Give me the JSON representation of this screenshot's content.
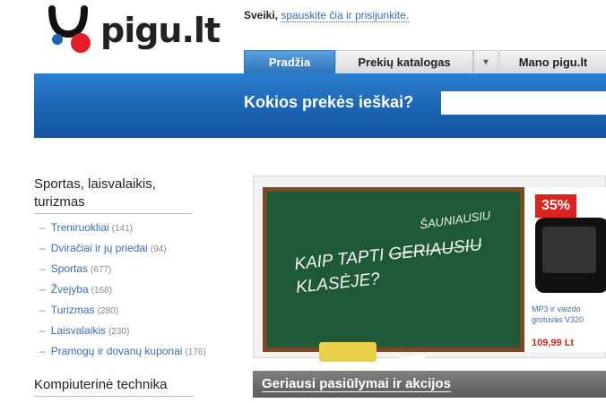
{
  "logo": {
    "text": "pigu.lt"
  },
  "greeting": {
    "hello": "Sveiki,",
    "login_link": "spauskite čia ir prisijunkite."
  },
  "tabs": {
    "home": "Pradžia",
    "catalog": "Prekių katalogas",
    "arrow": "▾",
    "mine": "Mano pigu.lt"
  },
  "search": {
    "label": "Kokios prekės ieškai?",
    "value": ""
  },
  "sidebar": {
    "category1": "Sportas, laisvalaikis, turizmas",
    "items": [
      {
        "label": "Treniruokliai",
        "count": "(141)"
      },
      {
        "label": "Dviračiai ir jų priedai",
        "count": "(94)"
      },
      {
        "label": "Sportas",
        "count": "(677)"
      },
      {
        "label": "Žvejyba",
        "count": "(168)"
      },
      {
        "label": "Turizmas",
        "count": "(280)"
      },
      {
        "label": "Laisvalaikis",
        "count": "(230)"
      },
      {
        "label": "Pramogų ir dovanų kuponai",
        "count": "(176)"
      }
    ],
    "category2": "Kompiuterinė technika"
  },
  "banner": {
    "line_top": "ŠAUNIAUSIU",
    "line1_start": "KAIP TAPTI ",
    "line1_strike": "GERIAUSIU",
    "line2": "KLASĖJE?",
    "discount": "35%",
    "product_name": "MP3 ir vaizdo grotuvas V320",
    "product_price": "109,99 Lt"
  },
  "promo": {
    "title": "Geriausi pasiūlymai ir akcijos"
  },
  "colors": {
    "accent_blue": "#1c64b2",
    "link": "#3b6bb5",
    "discount_red": "#d8231f"
  }
}
